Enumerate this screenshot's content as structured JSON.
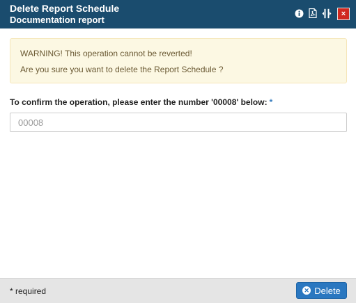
{
  "header": {
    "title": "Delete Report Schedule",
    "subtitle": "Documentation report",
    "icons": [
      "info-icon",
      "pdf-icon",
      "resize-icon"
    ],
    "close_label": "×",
    "bar_color": "#1a4c6e",
    "close_color": "#d0281f"
  },
  "warning": {
    "line1": "WARNING! This operation cannot be reverted!",
    "line2": "Are you sure you want to delete the Report Schedule ?"
  },
  "confirm": {
    "label": "To confirm the operation, please enter the number '00008' below:",
    "required_mark": "*",
    "placeholder": "00008",
    "value": ""
  },
  "footer": {
    "required_note": "* required",
    "delete_label": "Delete",
    "delete_color": "#2a77c0"
  }
}
